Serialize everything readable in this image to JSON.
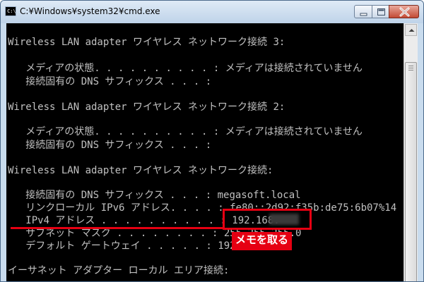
{
  "window": {
    "title": "C:¥Windows¥system32¥cmd.exe",
    "icon": "cmd-icon",
    "icon_text": "C:\\",
    "controls": [
      "minimize-icon",
      "maximize-icon",
      "close-icon"
    ]
  },
  "console": {
    "lines": [
      "Wireless LAN adapter ワイヤレス ネットワーク接続 3:",
      "",
      "   メディアの状態. . . . . . . . . . : メディアは接続されていません",
      "   接続固有の DNS サフィックス . . . :",
      "",
      "Wireless LAN adapter ワイヤレス ネットワーク接続 2:",
      "",
      "   メディアの状態. . . . . . . . . . : メディアは接続されていません",
      "   接続固有の DNS サフィックス . . . :",
      "",
      "Wireless LAN adapter ワイヤレス ネットワーク接続:",
      "",
      "   接続固有の DNS サフィックス . . . : megasoft.local",
      "   リンクローカル IPv6 アドレス. . . . : fe80::2d92:f35b:de75:6b07%14",
      "   IPv4 アドレス . . . . . . . . . . : 192.168.",
      "   サブネット マスク . . . . . . . . : 255.255.255.0",
      "   デフォルト ゲートウェイ . . . . . : 192.168.",
      "",
      "イーサネット アダプター ローカル エリア接続:"
    ]
  },
  "annotation": {
    "callout": "メモを取る",
    "color": "#e60012"
  },
  "colors": {
    "console_bg": "#000000",
    "console_text": "#c0c0c0"
  }
}
